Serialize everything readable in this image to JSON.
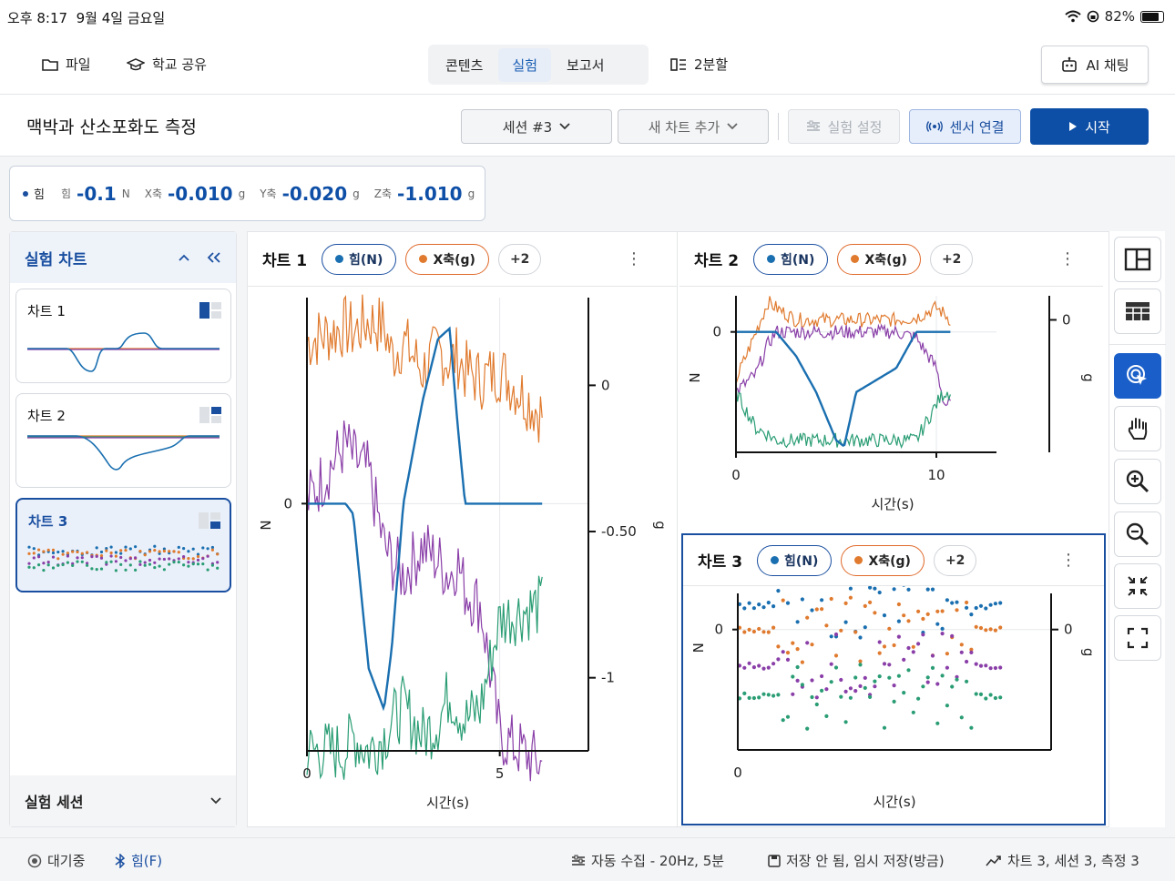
{
  "status": {
    "time": "오후 8:17",
    "date": "9월 4일 금요일",
    "battery": "82%",
    "battery_level": 0.82
  },
  "toolbar": {
    "file": "파일",
    "share": "학교 공유",
    "tabs": [
      "콘텐츠",
      "실험",
      "보고서"
    ],
    "split": "2분할",
    "ai_chat": "AI 채팅"
  },
  "header": {
    "title": "맥박과 산소포화도 측정",
    "session": "세션 #3",
    "add_chart": "새 차트 추가",
    "settings": "실험 설정",
    "sensor": "센서 연결",
    "start": "시작"
  },
  "reading": {
    "sensor": "힘",
    "items": [
      {
        "label": "힘",
        "value": "-0.1",
        "unit": "N"
      },
      {
        "label": "X축",
        "value": "-0.010",
        "unit": "g"
      },
      {
        "label": "Y축",
        "value": "-0.020",
        "unit": "g"
      },
      {
        "label": "Z축",
        "value": "-1.010",
        "unit": "g"
      }
    ]
  },
  "sidebar": {
    "title": "실험 차트",
    "charts": [
      "차트 1",
      "차트 2",
      "차트 3"
    ],
    "session_title": "실험 세션"
  },
  "colors": {
    "force": "#1a6fb0",
    "x": "#e07a2e",
    "y": "#8a3fa8",
    "z": "#2a9d74",
    "accent": "#0d4ea6"
  },
  "panels": {
    "chips": {
      "force": "힘(N)",
      "x": "X축(g)",
      "more": "+2"
    },
    "chart1": {
      "title": "차트 1",
      "xlabel": "시간(s)",
      "ylabel_left": "N",
      "ylabel_right": "g",
      "x_ticks": [
        "0",
        "5"
      ],
      "y_left_ticks": [
        "0"
      ],
      "y_right_ticks": [
        "0",
        "-0.50",
        "-1"
      ]
    },
    "chart2": {
      "title": "차트 2",
      "xlabel": "시간(s)",
      "ylabel_left": "N",
      "ylabel_right": "g",
      "x_ticks": [
        "0",
        "10"
      ],
      "y_left_ticks": [
        "0"
      ],
      "y_right_ticks": [
        "0"
      ]
    },
    "chart3": {
      "title": "차트 3",
      "xlabel": "시간(s)",
      "ylabel_left": "N",
      "ylabel_right": "g",
      "x_ticks": [
        "0"
      ],
      "y_left_ticks": [
        "0"
      ],
      "y_right_ticks": [
        "0"
      ]
    }
  },
  "chart_data": [
    {
      "type": "line",
      "title": "차트 1",
      "xlabel": "시간(s)",
      "ylabel": "N",
      "xlim": [
        0,
        7.3
      ],
      "ylim_left": [
        -1.2,
        1.0
      ],
      "ylim_right": [
        -1.25,
        0.3
      ],
      "x": [
        0,
        1,
        1.2,
        1.6,
        2.0,
        2.2,
        2.5,
        3.0,
        3.4,
        3.7,
        3.9,
        4.1,
        4.5,
        5,
        6.1
      ],
      "series": [
        {
          "name": "힘(N)",
          "axis": "left",
          "values": [
            0,
            0,
            -0.05,
            -0.8,
            -1.0,
            -0.7,
            0.0,
            0.5,
            0.8,
            0.85,
            0.4,
            0.0,
            0.0,
            0.0,
            0.0
          ]
        },
        {
          "name": "X축(g)",
          "axis": "right",
          "values": [
            0.15,
            0.2,
            0.18,
            0.22,
            0.2,
            0.1,
            0.15,
            0.05,
            0.12,
            0.08,
            0.1,
            0.05,
            0.02,
            0.05,
            -0.1
          ]
        },
        {
          "name": "Y축(g)",
          "axis": "right",
          "values": [
            -0.4,
            -0.2,
            -0.25,
            -0.3,
            -0.55,
            -0.6,
            -0.65,
            -0.55,
            -0.6,
            -0.65,
            -0.6,
            -0.7,
            -0.75,
            -1.2,
            -1.3
          ]
        },
        {
          "name": "Z축(g)",
          "axis": "right",
          "values": [
            -1.25,
            -1.25,
            -1.2,
            -1.25,
            -1.2,
            -1.15,
            -1.1,
            -1.2,
            -1.15,
            -1.05,
            -1.1,
            -1.15,
            -1.1,
            -0.8,
            -0.75
          ]
        }
      ]
    },
    {
      "type": "line",
      "title": "차트 2",
      "xlabel": "시간(s)",
      "ylabel": "N",
      "xlim": [
        0,
        13
      ],
      "ylim_left": [
        -1.0,
        0.3
      ],
      "ylim_right": [
        -1.1,
        0.2
      ],
      "x": [
        0,
        1,
        1.6,
        2,
        3,
        4,
        5,
        5.4,
        6,
        7,
        8,
        9,
        10,
        10.4,
        10.7
      ],
      "series": [
        {
          "name": "힘(N)",
          "axis": "left",
          "values": [
            0,
            0,
            0,
            0,
            -0.2,
            -0.5,
            -0.9,
            -0.95,
            -0.5,
            -0.4,
            -0.3,
            0.0,
            0.0,
            0.0,
            0.0
          ]
        },
        {
          "name": "X축(g)",
          "axis": "right",
          "values": [
            -0.5,
            -0.1,
            0.15,
            0.1,
            0.0,
            0.0,
            0.0,
            0.0,
            0.0,
            0.0,
            0.0,
            0.02,
            0.1,
            0.05,
            0.0
          ]
        },
        {
          "name": "Y축(g)",
          "axis": "right",
          "values": [
            -0.6,
            -0.45,
            -0.2,
            -0.1,
            -0.1,
            -0.1,
            -0.1,
            -0.1,
            -0.1,
            -0.1,
            -0.1,
            -0.15,
            -0.4,
            -0.7,
            -0.7
          ]
        },
        {
          "name": "Z축(g)",
          "axis": "right",
          "values": [
            -0.6,
            -0.9,
            -0.95,
            -1.0,
            -1.0,
            -1.0,
            -1.0,
            -1.0,
            -1.0,
            -1.0,
            -1.0,
            -1.0,
            -0.7,
            -0.6,
            -0.6
          ]
        }
      ]
    },
    {
      "type": "scatter",
      "title": "차트 3",
      "xlabel": "시간(s)",
      "ylabel": "N",
      "xlim": [
        0,
        13
      ],
      "ylim": [
        -1.0,
        0.3
      ],
      "series": [
        {
          "name": "힘(N)",
          "baseline": 0.2
        },
        {
          "name": "X축(g)",
          "baseline": 0.0
        },
        {
          "name": "Y축(g)",
          "baseline": -0.3
        },
        {
          "name": "Z축(g)",
          "baseline": -0.55
        }
      ]
    }
  ],
  "bottom": {
    "status": "대기중",
    "sensor": "힘(F)",
    "auto": "자동 수집 - 20Hz, 5분",
    "save": "저장 안 됨, 임시 저장(방금)",
    "summary": "차트 3, 세션 3, 측정 3"
  }
}
